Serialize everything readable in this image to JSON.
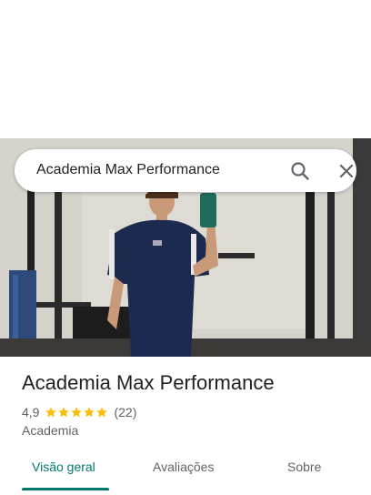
{
  "search": {
    "query": "Academia Max Performance"
  },
  "place": {
    "name": "Academia Max Performance",
    "rating": "4,9",
    "stars": 5,
    "review_count": "(22)",
    "category": "Academia"
  },
  "tabs": [
    {
      "label": "Visão geral",
      "active": true
    },
    {
      "label": "Avaliações",
      "active": false
    },
    {
      "label": "Sobre",
      "active": false
    }
  ],
  "colors": {
    "accent": "#01786f",
    "star": "#fbbc04"
  }
}
